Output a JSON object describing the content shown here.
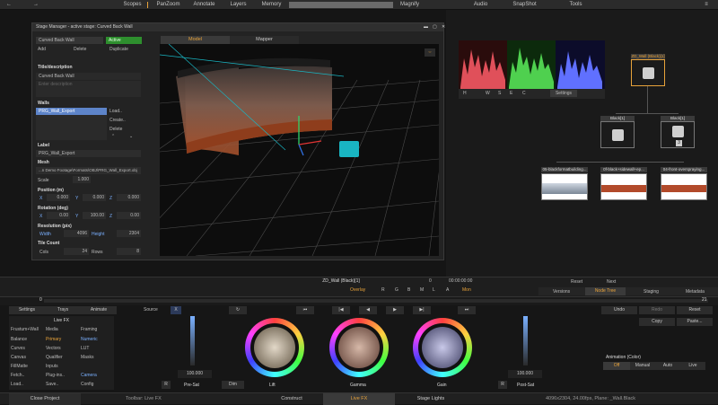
{
  "topbar": {
    "back_glyph": "←",
    "fwd_glyph": "→",
    "items": [
      "Scopes",
      "PanZoom",
      "Annotate",
      "Layers",
      "Memory",
      "Magnify",
      "Audio",
      "SnapShot",
      "Tools"
    ],
    "menu_glyph": "≡"
  },
  "dialog": {
    "title": "Stage Manager - active stage: Curved Back Wall",
    "ctl_minimize": "▬",
    "ctl_restore": "▢",
    "ctl_close": "✕",
    "stage_select": "Curved Back Wall",
    "active_label": "Active",
    "add": "Add",
    "delete": "Delete",
    "duplicate": "Duplicate",
    "title_desc_label": "Title/description",
    "title_value": "Curved Back Wall",
    "desc_placeholder": "Enter description",
    "walls_label": "Walls",
    "wall_item": "PRG_Wall_Export",
    "load": "Load..",
    "create": "Create..",
    "delete2": "Delete",
    "arrow_up": "⌃",
    "arrow_down": "⌄",
    "label_label": "Label",
    "label_value": "PRG_Wall_Export",
    "mesh_label": "Mesh",
    "mesh_value": "...n Demo Footage\\Formats\\OBJ\\PRG_Wall_Export.obj",
    "scale_label": "Scale",
    "scale_value": "1.000",
    "position_label": "Position (m)",
    "pos_x": "0.000",
    "pos_y": "0.000",
    "pos_z": "0.000",
    "rotation_label": "Rotation (deg)",
    "rot_x": "0.00",
    "rot_y": "100.00",
    "rot_z": "0.00",
    "resolution_label": "Resolution (pix)",
    "width_label": "Width",
    "width_value": "4096",
    "height_label": "Height",
    "height_value": "2304",
    "tile_label": "Tile Count",
    "cols_label": "Cols",
    "cols_value": "24",
    "rows_label": "Rows",
    "rows_value": "8",
    "tab_model": "Model",
    "tab_mapper": "Mapper",
    "x": "X",
    "y": "Y",
    "z": "Z",
    "vp_icon": "⇔"
  },
  "scopes": {
    "settings": "Settings",
    "buttons": [
      "H",
      "W",
      "S",
      "E",
      "C"
    ]
  },
  "nodes": {
    "top": "ZD_Wall (Black)[1]",
    "mid1": "Black[1]",
    "mid2": "Black[1]",
    "mid2_badge": "3",
    "bottom1": "05-blackformatbuilding...",
    "bottom2": "0f-black+sidewall+ep...",
    "bottom3": "04-front-overspraying..."
  },
  "transport": {
    "clip_name": "ZD_Wall (Black)[1]",
    "tc_left": "0",
    "timecode": "00:00:00:00",
    "overlay": "Overlay",
    "channels": [
      "R",
      "G",
      "B",
      "M",
      "L",
      "A"
    ],
    "mon": "Mon"
  },
  "right_panel": {
    "reset": "Reset",
    "next": "Next",
    "tabs": [
      "Versions",
      "Node Tree",
      "Staging",
      "Metadata"
    ],
    "frame": "21"
  },
  "color": {
    "frame_zero": "0",
    "tabs": [
      "Settings",
      "Trays",
      "Animate"
    ],
    "source": "Source",
    "x_glyph": "X",
    "live_fx": "Live FX",
    "menu_col1": [
      "Frustum+Wall",
      "Balance",
      "Curves",
      "Canvas",
      "FillMatte",
      "Fetch..",
      "Load.."
    ],
    "menu_col2": [
      "Media",
      "Primary",
      "Vectors",
      "Qualifier",
      "Inputs",
      "Plug-ins..",
      "Save.."
    ],
    "menu_col3": [
      "Framing",
      "Numeric",
      "LUT",
      "Masks",
      "",
      "Camera",
      "Config"
    ],
    "pre_sat": "Pre-Sat",
    "post_sat": "Post-Sat",
    "pre_val": "100.000",
    "post_val": "100.000",
    "wheels": [
      "Lift",
      "Gamma",
      "Gain"
    ],
    "dim": "Dim",
    "r_glyph": "R",
    "undo": "Undo",
    "redo": "Redo",
    "reset": "Reset",
    "copy": "Copy",
    "paste": "Paste...",
    "animation_label": "Animation (Color)",
    "anim_modes": [
      "Off",
      "Manual",
      "Auto",
      "Live"
    ],
    "play_glyphs": [
      "↻",
      "⏮",
      "|◀",
      "◀",
      "▶",
      "▶|",
      "⏭"
    ]
  },
  "bottombar": {
    "close_project": "Close Project",
    "toolbar": "Toolbar: Live FX",
    "construct": "Construct",
    "live_fx": "Live FX",
    "stage_lights": "Stage Lights",
    "info": "4096x2304, 24.00fps, Plane: _Wall.Black"
  },
  "colors": {
    "accent": "#e8a33a",
    "active_green": "#2e8f2e",
    "wall_selected": "#5d84c9",
    "cube": "#19b5c2"
  }
}
